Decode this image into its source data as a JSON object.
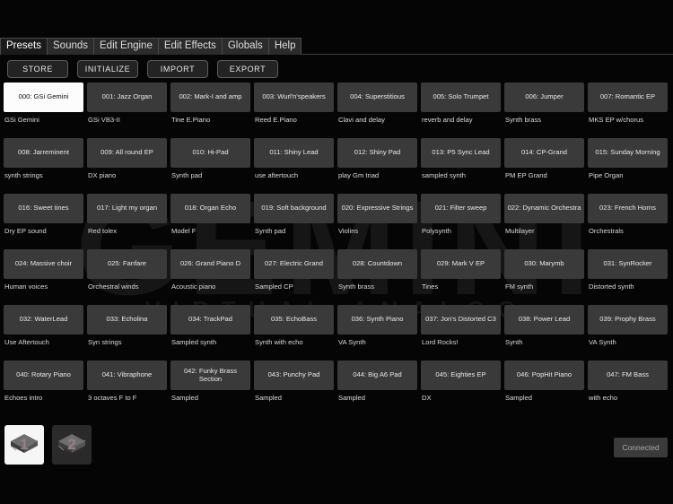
{
  "app": {
    "watermark": "GEMINI",
    "watermark_sub": "VIRTUAL ANALOG",
    "accent_color": "#9c7d8e",
    "selected_pad_color": "#fcfcfc",
    "pad_color": "#3a3a3a"
  },
  "tabs": [
    {
      "label": "Presets",
      "active": true
    },
    {
      "label": "Sounds",
      "active": false
    },
    {
      "label": "Edit Engine",
      "active": false
    },
    {
      "label": "Edit Effects",
      "active": false
    },
    {
      "label": "Globals",
      "active": false
    },
    {
      "label": "Help",
      "active": false
    }
  ],
  "toolbar": {
    "buttons": [
      {
        "label": "STORE"
      },
      {
        "label": "INITIALIZE"
      },
      {
        "label": "IMPORT"
      },
      {
        "label": "EXPORT"
      }
    ]
  },
  "presets": [
    {
      "name": "000: GSi Gemini",
      "sub": "GSi Gemini",
      "selected": true
    },
    {
      "name": "001: Jazz Organ",
      "sub": "GSi VB3-II",
      "selected": false
    },
    {
      "name": "002: Mark-I and amp",
      "sub": "Tine E.Piano",
      "selected": false
    },
    {
      "name": "003: Wurl'n'speakers",
      "sub": "Reed E.Piano",
      "selected": false
    },
    {
      "name": "004: Superstitious",
      "sub": "Clavi and delay",
      "selected": false
    },
    {
      "name": "005: Solo Trumpet",
      "sub": "reverb and delay",
      "selected": false
    },
    {
      "name": "006: Jumper",
      "sub": "Synth brass",
      "selected": false
    },
    {
      "name": "007: Romantic EP",
      "sub": "MKS EP w/chorus",
      "selected": false
    },
    {
      "name": "008: Jarreminent",
      "sub": "synth strings",
      "selected": false
    },
    {
      "name": "009: All round EP",
      "sub": "DX piano",
      "selected": false
    },
    {
      "name": "010: Hi-Pad",
      "sub": "Synth pad",
      "selected": false
    },
    {
      "name": "011: Shiny Lead",
      "sub": "use aftertouch",
      "selected": false
    },
    {
      "name": "012: Shiny Pad",
      "sub": "play Gm triad",
      "selected": false
    },
    {
      "name": "013: P5 Sync Lead",
      "sub": "sampled synth",
      "selected": false
    },
    {
      "name": "014: CP-Grand",
      "sub": "PM EP Grand",
      "selected": false
    },
    {
      "name": "015: Sunday Morning",
      "sub": "Pipe Organ",
      "selected": false
    },
    {
      "name": "016: Sweet tines",
      "sub": "Dry EP sound",
      "selected": false
    },
    {
      "name": "017: Light my organ",
      "sub": "Red tolex",
      "selected": false
    },
    {
      "name": "018: Organ Echo",
      "sub": "Model F",
      "selected": false
    },
    {
      "name": "019: Soft background",
      "sub": "Synth pad",
      "selected": false
    },
    {
      "name": "020: Expressive Strings",
      "sub": "Violins",
      "selected": false
    },
    {
      "name": "021: Filter sweep",
      "sub": "Polysynth",
      "selected": false
    },
    {
      "name": "022: Dynamic Orchestra",
      "sub": "Multilayer",
      "selected": false
    },
    {
      "name": "023: French Horns",
      "sub": "Orchestrals",
      "selected": false
    },
    {
      "name": "024: Massive choir",
      "sub": "Human voices",
      "selected": false
    },
    {
      "name": "025: Fanfare",
      "sub": "Orchestral winds",
      "selected": false
    },
    {
      "name": "026: Grand Piano D",
      "sub": "Acoustic piano",
      "selected": false
    },
    {
      "name": "027: Electric Grand",
      "sub": "Sampled CP",
      "selected": false
    },
    {
      "name": "028: Countdown",
      "sub": "Synth brass",
      "selected": false
    },
    {
      "name": "029: Mark V EP",
      "sub": "Tines",
      "selected": false
    },
    {
      "name": "030: Marymb",
      "sub": "FM synth",
      "selected": false
    },
    {
      "name": "031: SynRocker",
      "sub": "Distorted synth",
      "selected": false
    },
    {
      "name": "032: WaterLead",
      "sub": "Use Aftertouch",
      "selected": false
    },
    {
      "name": "033: Echolina",
      "sub": "Syn strings",
      "selected": false
    },
    {
      "name": "034: TrackPad",
      "sub": "Sampled synth",
      "selected": false
    },
    {
      "name": "035: EchoBass",
      "sub": "Synth with echo",
      "selected": false
    },
    {
      "name": "036: Synth Piano",
      "sub": "VA Synth",
      "selected": false
    },
    {
      "name": "037: Jon's Distorted C3",
      "sub": "Lord Rocks!",
      "selected": false
    },
    {
      "name": "038: Power Lead",
      "sub": "Synth",
      "selected": false
    },
    {
      "name": "039: Prophy Brass",
      "sub": "VA Synth",
      "selected": false
    },
    {
      "name": "040: Rotary Piano",
      "sub": "Echoes intro",
      "selected": false
    },
    {
      "name": "041: Vibraphone",
      "sub": "3 octaves F to F",
      "selected": false
    },
    {
      "name": "042: Funky Brass Section",
      "sub": "Sampled",
      "selected": false
    },
    {
      "name": "043: Punchy Pad",
      "sub": "Sampled",
      "selected": false
    },
    {
      "name": "044: Big A6 Pad",
      "sub": "Sampled",
      "selected": false
    },
    {
      "name": "045: Eighties EP",
      "sub": "DX",
      "selected": false
    },
    {
      "name": "046: PopHit Piano",
      "sub": "Sampled",
      "selected": false
    },
    {
      "name": "047: FM Bass",
      "sub": "with echo",
      "selected": false
    }
  ],
  "banks": [
    {
      "label": "1",
      "icon": "chip-icon",
      "selected": true
    },
    {
      "label": "2",
      "icon": "chip-icon",
      "selected": false
    }
  ],
  "status": {
    "connection_label": "Connected"
  }
}
